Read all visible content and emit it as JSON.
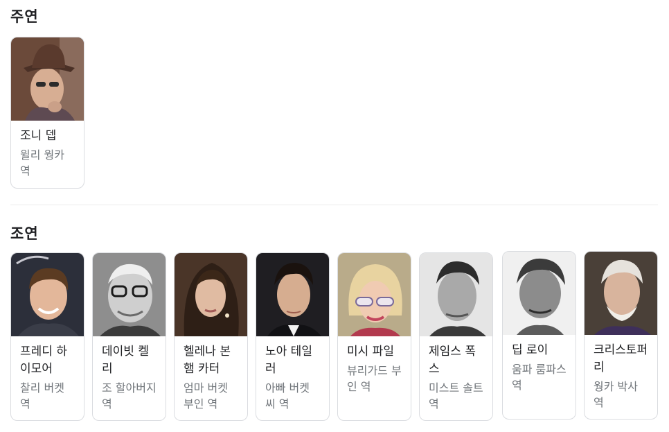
{
  "sections": {
    "main_cast_title": "주연",
    "supporting_cast_title": "조연"
  },
  "main_cast": [
    {
      "name": "조니 뎁",
      "role": "윌리 웡카 역",
      "icon": "actor-photo"
    }
  ],
  "supporting_cast": [
    {
      "name": "프레디 하이모어",
      "role": "찰리 버켓 역"
    },
    {
      "name": "데이빗 켈리",
      "role": "조 할아버지 역"
    },
    {
      "name": "헬레나 본햄 카터",
      "role": "엄마 버켓 부인 역"
    },
    {
      "name": "노아 테일러",
      "role": "아빠 버켓 씨 역"
    },
    {
      "name": "미시 파일",
      "role": "뷰리가드 부인 역"
    },
    {
      "name": "제임스 폭스",
      "role": "미스트 솔트 역"
    },
    {
      "name": "딥 로이",
      "role": "움파 룸파스 역"
    },
    {
      "name": "크리스토퍼 리",
      "role": "웡카 박사 역"
    }
  ],
  "colors": {
    "title_text": "#202124",
    "secondary_text": "#70757a",
    "card_border": "#dadce0"
  }
}
